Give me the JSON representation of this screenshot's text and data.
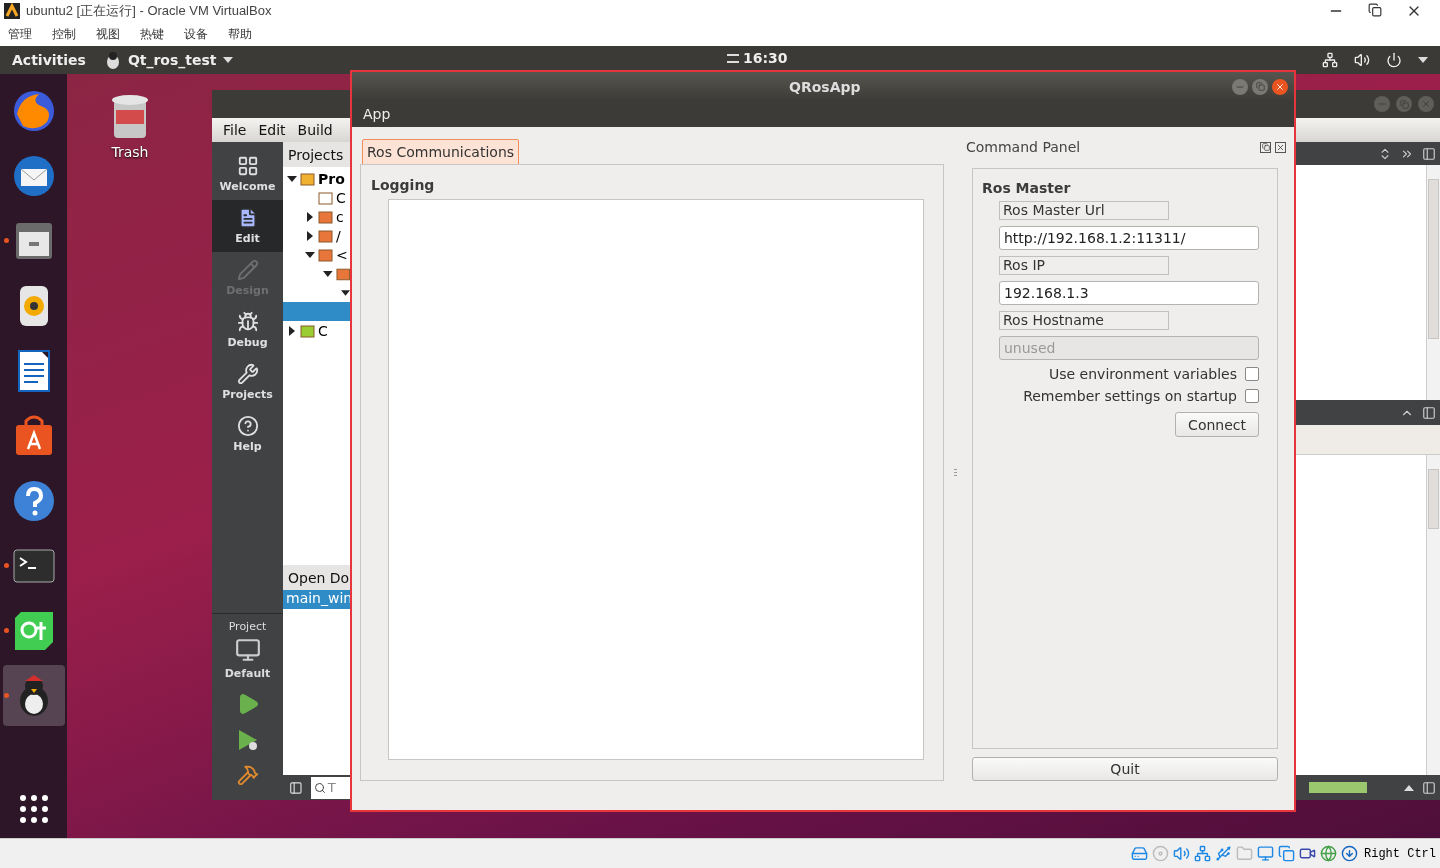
{
  "host": {
    "title": "ubuntu2 [正在运行] - Oracle VM VirtualBox",
    "menu": [
      "管理",
      "控制",
      "视图",
      "热键",
      "设备",
      "帮助"
    ]
  },
  "topbar": {
    "activities": "Activities",
    "app_name": "Qt_ros_test",
    "clock": "16:30"
  },
  "dock": [
    {
      "kind": "browser",
      "running": false,
      "selected": false
    },
    {
      "kind": "mail",
      "running": false,
      "selected": false
    },
    {
      "kind": "files",
      "running": true,
      "selected": false
    },
    {
      "kind": "music",
      "running": false,
      "selected": false
    },
    {
      "kind": "writer",
      "running": false,
      "selected": false
    },
    {
      "kind": "store",
      "running": false,
      "selected": false
    },
    {
      "kind": "help",
      "running": false,
      "selected": false
    },
    {
      "kind": "terminal",
      "running": true,
      "selected": false
    },
    {
      "kind": "qt",
      "running": true,
      "selected": false
    },
    {
      "kind": "robot",
      "running": true,
      "selected": true
    }
  ],
  "desktop": {
    "trash_label": "Trash"
  },
  "qt_creator": {
    "menu": [
      "File",
      "Edit",
      "Build"
    ],
    "modes": [
      {
        "kind": "welcome",
        "label": "Welcome",
        "selected": false,
        "disabled": false
      },
      {
        "kind": "edit",
        "label": "Edit",
        "selected": true,
        "disabled": false
      },
      {
        "kind": "design",
        "label": "Design",
        "selected": false,
        "disabled": true
      },
      {
        "kind": "debug",
        "label": "Debug",
        "selected": false,
        "disabled": false
      },
      {
        "kind": "projects",
        "label": "Projects",
        "selected": false,
        "disabled": false
      },
      {
        "kind": "help",
        "label": "Help",
        "selected": false,
        "disabled": false
      }
    ],
    "kit": {
      "title": "Project",
      "name": "Default"
    },
    "projects_title": "Projects",
    "tree": [
      {
        "kind": "project",
        "label": "Pro",
        "expanded": true,
        "selected": false,
        "children": [
          {
            "kind": "file",
            "label": "C",
            "selected": false
          },
          {
            "kind": "pfolder",
            "label": "c",
            "expanded": false,
            "selected": false
          },
          {
            "kind": "folder",
            "label": "/",
            "expanded": false,
            "selected": false
          },
          {
            "kind": "hfolder",
            "label": "<",
            "expanded": true,
            "selected": false,
            "children": [
              {
                "kind": "folder",
                "expanded": true,
                "selected": false,
                "children": [
                  {
                    "expanded": true,
                    "selected": false,
                    "children": [
                      {
                        "selected": true
                      }
                    ]
                  }
                ]
              }
            ]
          }
        ]
      },
      {
        "kind": "cube",
        "label": "C",
        "expanded": false,
        "selected": false
      }
    ],
    "open_documents_title": "Open Do",
    "documents": [
      {
        "label": "main_win",
        "selected": true
      }
    ],
    "search": {
      "placeholder": "T"
    },
    "build_progress": {
      "level": 1
    }
  },
  "qrosapp": {
    "title": "QRosApp",
    "menu": [
      "App"
    ],
    "tabs": [
      {
        "label": "Ros Communications",
        "selected": true
      }
    ],
    "logging_title": "Logging",
    "panel_title": "Command Panel",
    "group_title": "Ros Master",
    "fields": [
      {
        "label": "Ros Master Url",
        "value": "http://192.168.1.2:11311/",
        "disabled": false
      },
      {
        "label": "Ros IP",
        "value": "192.168.1.3",
        "disabled": false
      },
      {
        "label": "Ros Hostname",
        "value": "unused",
        "disabled": true
      }
    ],
    "checkboxes": [
      {
        "label": "Use environment variables",
        "checked": false
      },
      {
        "label": "Remember settings on startup",
        "checked": false
      }
    ],
    "connect": "Connect",
    "quit": "Quit"
  },
  "statusbar": {
    "host_key": "Right Ctrl"
  }
}
